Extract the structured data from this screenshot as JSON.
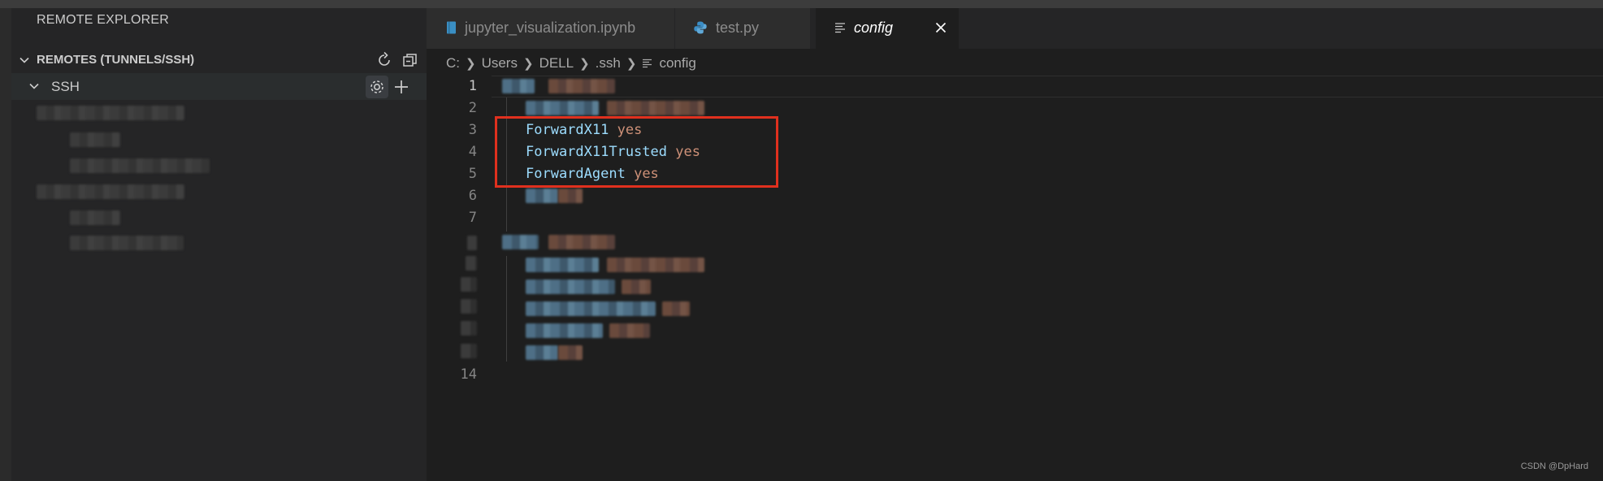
{
  "sidebar": {
    "title": "REMOTE EXPLORER",
    "section_label": "REMOTES (TUNNELS/SSH)",
    "ssh_label": "SSH"
  },
  "tabs": [
    {
      "label": "jupyter_visualization.ipynb",
      "icon": "notebook-icon",
      "active": false
    },
    {
      "label": "test.py",
      "icon": "python-icon",
      "active": false
    },
    {
      "label": "config",
      "icon": "lines-icon",
      "active": true
    }
  ],
  "breadcrumb": {
    "items": [
      "C:",
      "Users",
      "DELL",
      ".ssh",
      "config"
    ]
  },
  "editor": {
    "line_numbers": [
      "1",
      "2",
      "3",
      "4",
      "5",
      "6",
      "7",
      "14"
    ],
    "lines": [
      {
        "key": "ForwardX11",
        "value": "yes"
      },
      {
        "key": "ForwardX11Trusted",
        "value": "yes"
      },
      {
        "key": "ForwardAgent",
        "value": "yes"
      }
    ]
  },
  "colors": {
    "key": "#9cdcfe",
    "value": "#ce9178",
    "highlight_box": "#e0301e",
    "editor_bg": "#1e1e1e",
    "sidebar_bg": "#252526"
  },
  "watermark": "CSDN @DpHard"
}
